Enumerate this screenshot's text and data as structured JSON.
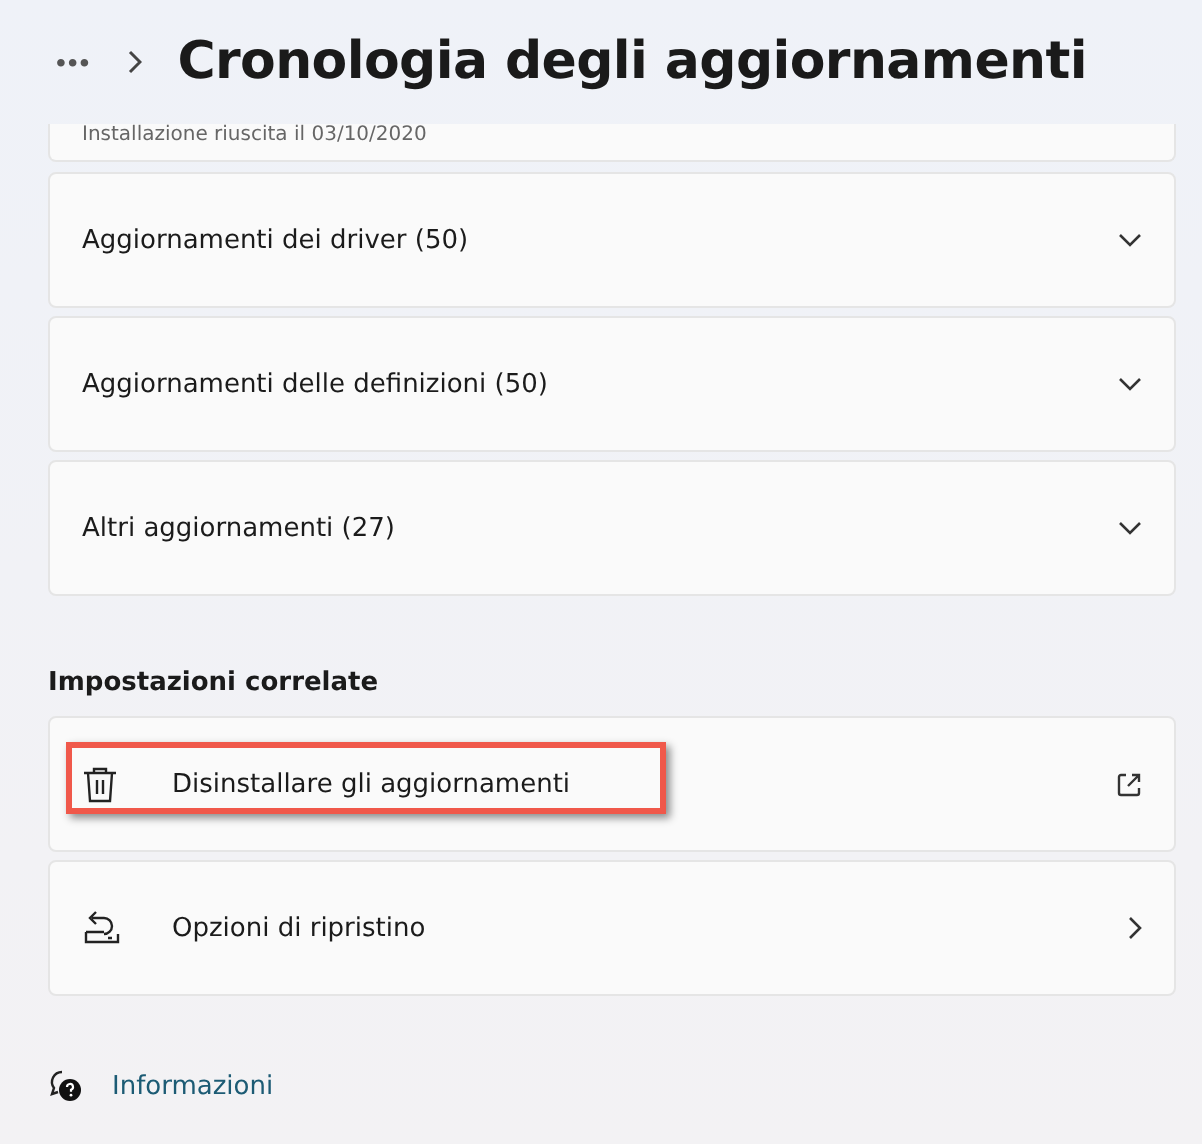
{
  "breadcrumb": {
    "overflow": "•••",
    "title": "Cronologia degli aggiornamenti"
  },
  "partial_item": {
    "text": "Installazione riuscita il 03/10/2020"
  },
  "groups": [
    {
      "label": "Aggiornamenti dei driver (50)",
      "expanded": false
    },
    {
      "label": "Aggiornamenti delle definizioni (50)",
      "expanded": false
    },
    {
      "label": "Altri aggiornamenti (27)",
      "expanded": false
    }
  ],
  "related": {
    "heading": "Impostazioni correlate",
    "items": [
      {
        "label": "Disinstallare gli aggiornamenti",
        "kind": "external",
        "highlighted": true
      },
      {
        "label": "Opzioni di ripristino",
        "kind": "navigate",
        "highlighted": false
      }
    ]
  },
  "help_link": "Informazioni"
}
